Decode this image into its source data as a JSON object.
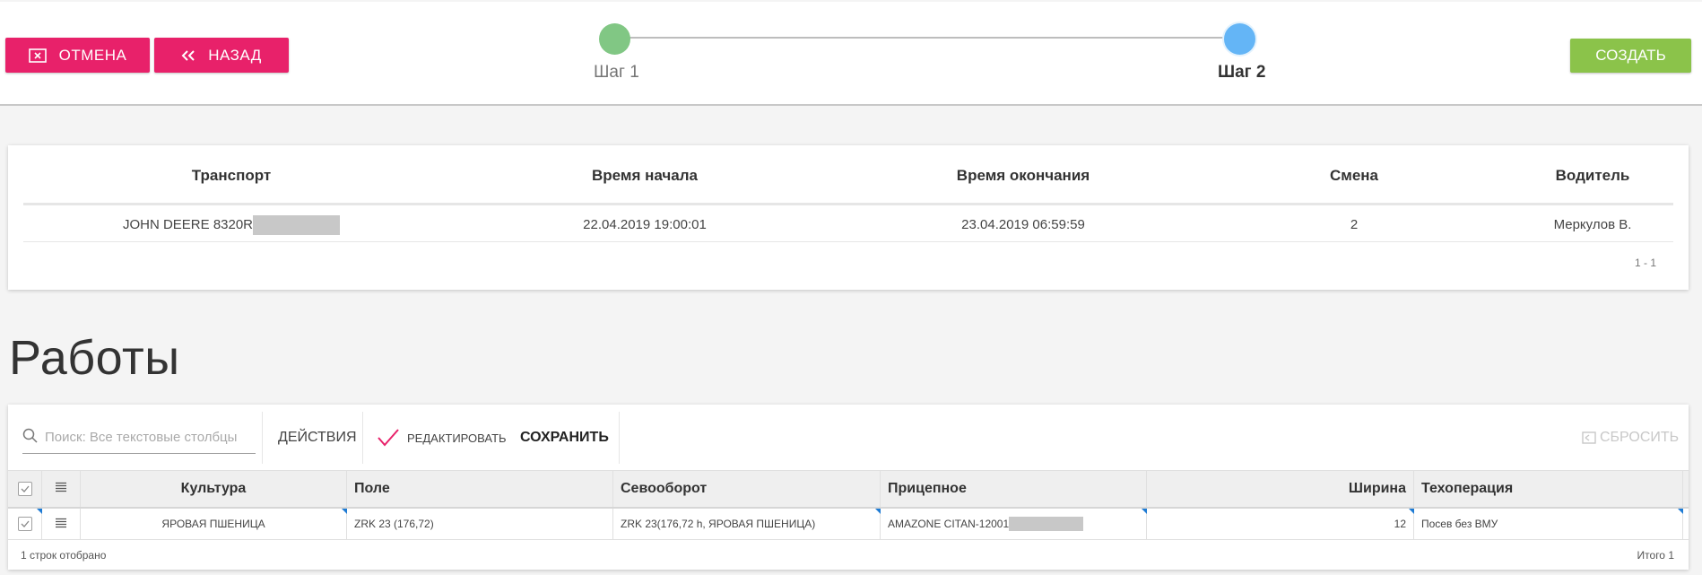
{
  "header": {
    "cancel_label": "ОТМЕНА",
    "back_label": "НАЗАД",
    "create_label": "СОЗДАТЬ",
    "steps": [
      {
        "label": "Шаг 1",
        "state": "done",
        "color": "#81c784"
      },
      {
        "label": "Шаг 2",
        "state": "active",
        "color": "#64b5f6"
      }
    ],
    "colors": {
      "danger": "#e8216a",
      "success": "#8bc34a"
    }
  },
  "transport_table": {
    "columns": [
      "Транспорт",
      "Время начала",
      "Время окончания",
      "Смена",
      "Водитель"
    ],
    "rows": [
      {
        "transport": "JOHN DEERE 8320R",
        "start": "22.04.2019 19:00:01",
        "end": "23.04.2019 06:59:59",
        "shift": "2",
        "driver": "Меркулов В."
      }
    ],
    "pager": "1 - 1"
  },
  "works": {
    "title": "Работы",
    "search_placeholder": "Поиск: Все текстовые столбцы",
    "actions_label": "ДЕЙСТВИЯ",
    "edit_label": "РЕДАКТИРОВАТЬ",
    "save_label": "СОХРАНИТЬ",
    "reset_label": "СБРОСИТЬ",
    "columns": [
      "Культура",
      "Поле",
      "Севооборот",
      "Прицепное",
      "Ширина",
      "Техоперация"
    ],
    "rows": [
      {
        "culture": "ЯРОВАЯ ПШЕНИЦА",
        "field": "ZRK 23 (176,72)",
        "rotation": "ZRK 23(176,72 h, ЯРОВАЯ ПШЕНИЦА)",
        "trailer": "AMAZONE CITAN-12001",
        "width": "12",
        "operation": "Посев без ВМУ"
      }
    ],
    "footer_count": "1 строк отобрано",
    "footer_total": "Итого 1"
  }
}
